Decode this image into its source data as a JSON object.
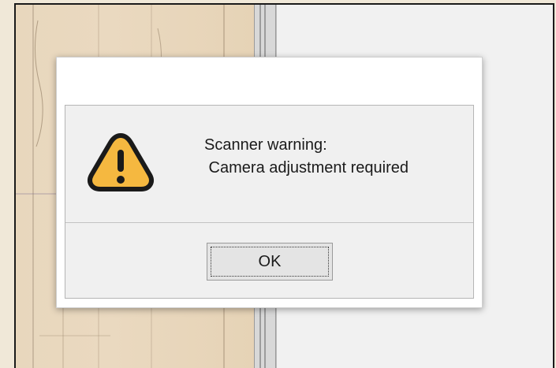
{
  "dialog": {
    "title": "",
    "message_line1": "Scanner warning:",
    "message_line2": " Camera adjustment required",
    "icon": "warning-icon",
    "ok_label": "OK"
  },
  "colors": {
    "warning_fill": "#f5b840",
    "warning_outline": "#1a1a1a",
    "document_background": "#e8d7bd",
    "dialog_body": "#f0f0f0"
  }
}
